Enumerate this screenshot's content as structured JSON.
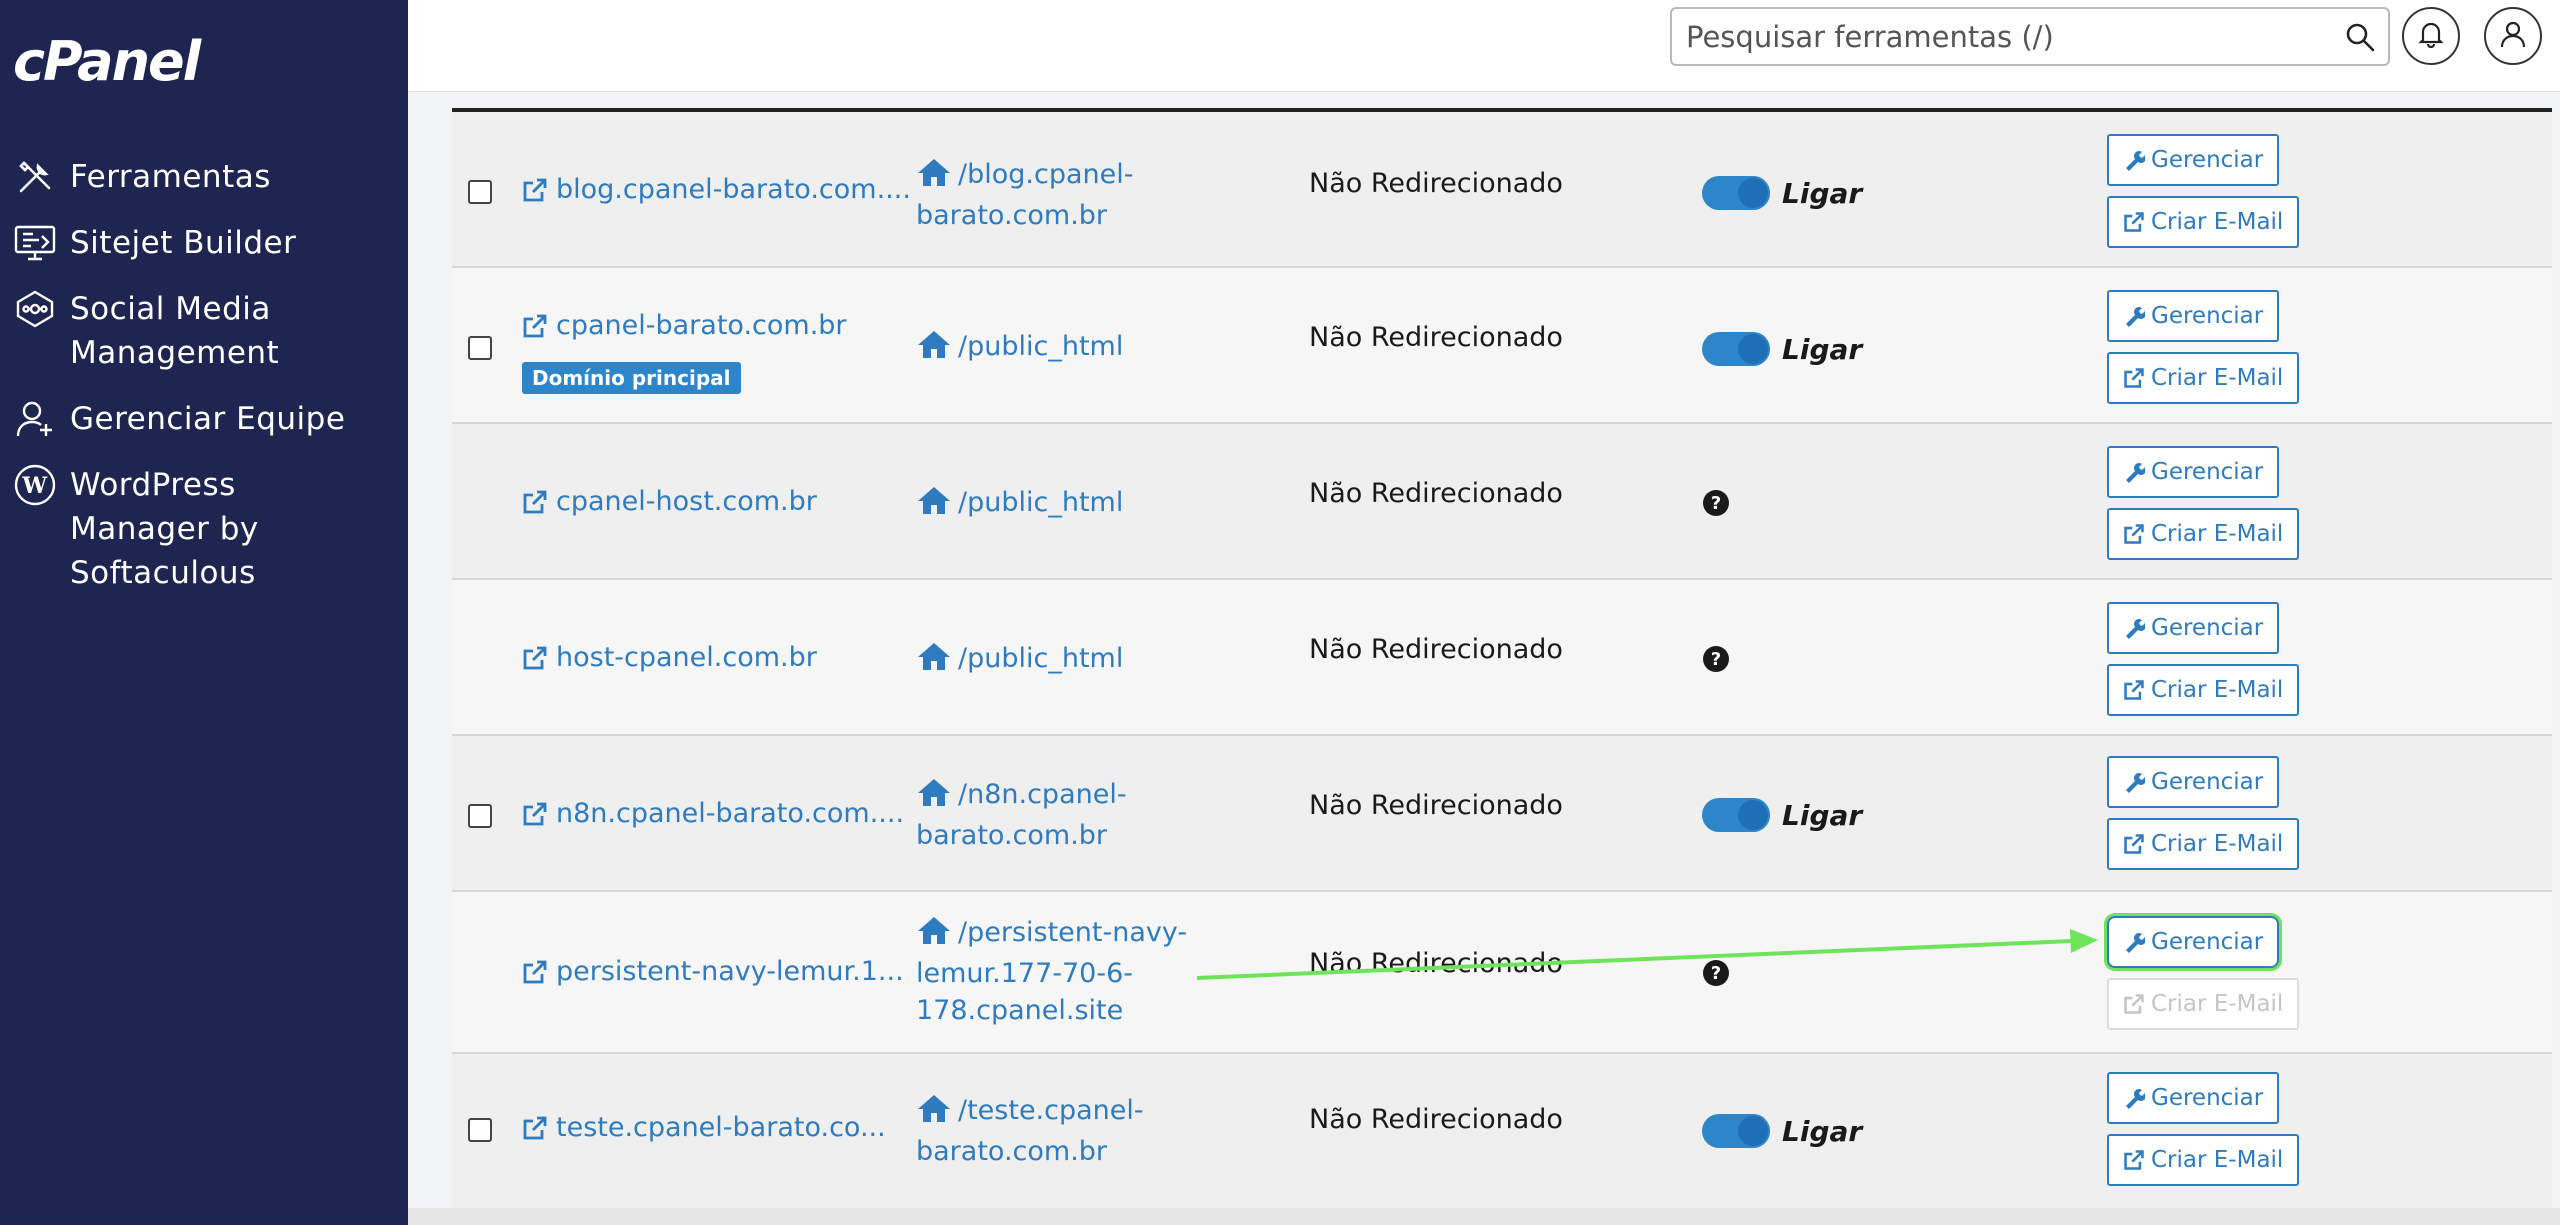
{
  "brand": {
    "logo_text": "cPanel"
  },
  "sidebar": {
    "items": [
      {
        "label": "Ferramentas",
        "icon": "tools-icon"
      },
      {
        "label": "Sitejet Builder",
        "icon": "monitor-builder-icon"
      },
      {
        "label": "Social Media\nManagement",
        "icon": "social-media-icon"
      },
      {
        "label": "Gerenciar Equipe",
        "icon": "team-user-icon"
      },
      {
        "label": "WordPress\nManager by\nSoftaculous",
        "icon": "wordpress-icon"
      }
    ]
  },
  "header": {
    "search_placeholder": "Pesquisar ferramentas (/)"
  },
  "table": {
    "rows": [
      {
        "domain": "blog.cpanel-barato.com....",
        "docroot": "/blog.cpanel-\nbarato.com.br",
        "redirect": "Não Redirecionado",
        "has_checkbox": true,
        "status": "toggle",
        "toggle_label": "Ligar",
        "manage_label": "Gerenciar",
        "email_label": "Criar E-Mail"
      },
      {
        "domain": "cpanel-barato.com.br",
        "badge": "Domínio principal",
        "docroot": "/public_html",
        "redirect": "Não Redirecionado",
        "has_checkbox": true,
        "status": "toggle",
        "toggle_label": "Ligar",
        "manage_label": "Gerenciar",
        "email_label": "Criar E-Mail"
      },
      {
        "domain": "cpanel-host.com.br",
        "docroot": "/public_html",
        "redirect": "Não Redirecionado",
        "has_checkbox": false,
        "status": "unknown",
        "manage_label": "Gerenciar",
        "email_label": "Criar E-Mail"
      },
      {
        "domain": "host-cpanel.com.br",
        "docroot": "/public_html",
        "redirect": "Não Redirecionado",
        "has_checkbox": false,
        "status": "unknown",
        "manage_label": "Gerenciar",
        "email_label": "Criar E-Mail"
      },
      {
        "domain": "n8n.cpanel-barato.com....",
        "docroot": "/n8n.cpanel-\nbarato.com.br",
        "redirect": "Não Redirecionado",
        "has_checkbox": true,
        "status": "toggle",
        "toggle_label": "Ligar",
        "manage_label": "Gerenciar",
        "email_label": "Criar E-Mail"
      },
      {
        "domain": "persistent-navy-lemur.1...",
        "docroot": "/persistent-navy-\nlemur.177-70-6-\n178.cpanel.site",
        "redirect": "Não Redirecionado",
        "has_checkbox": false,
        "status": "unknown",
        "manage_label": "Gerenciar",
        "email_label": "Criar E-Mail",
        "email_disabled": true,
        "highlighted": true
      },
      {
        "domain": "teste.cpanel-barato.co...",
        "docroot": "/teste.cpanel-\nbarato.com.br",
        "redirect": "Não Redirecionado",
        "has_checkbox": true,
        "status": "toggle",
        "toggle_label": "Ligar",
        "manage_label": "Gerenciar",
        "email_label": "Criar E-Mail"
      }
    ]
  },
  "colors": {
    "sidebar_bg": "#1d2550",
    "link": "#2f7bbf",
    "toggle_on": "#2d86c9",
    "annotation_arrow": "#6fe35a"
  }
}
